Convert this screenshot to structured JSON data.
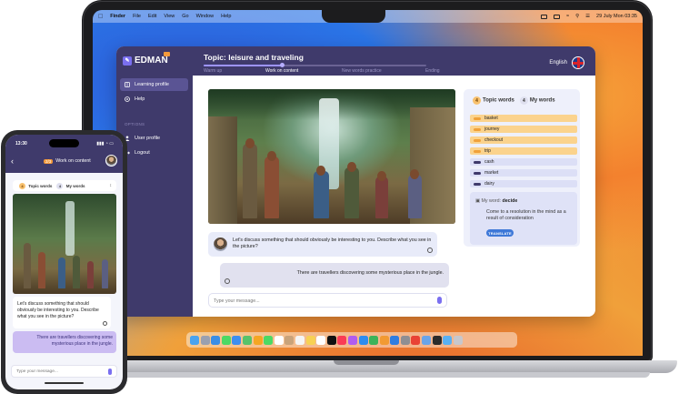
{
  "menubar": {
    "items": [
      "Finder",
      "File",
      "Edit",
      "View",
      "Go",
      "Window",
      "Help"
    ],
    "datetime": "29 July Mon  03:35"
  },
  "app": {
    "brand": "EDMAN",
    "topic_title": "Topic: leisure and traveling",
    "progress": 0.35,
    "steps": [
      "Warm up",
      "Work on content",
      "New words practice",
      "Ending"
    ],
    "active_step": 1,
    "language": "English",
    "sidebar": {
      "items": [
        {
          "label": "Learning profile",
          "icon": "book-icon"
        },
        {
          "label": "Help",
          "icon": "help-icon"
        }
      ],
      "section_label": "OPTIONS",
      "options": [
        {
          "label": "User profile",
          "icon": "user-icon"
        },
        {
          "label": "Logout",
          "icon": "logout-icon"
        }
      ]
    },
    "chat": {
      "bot_message": "Let's discuss something that should obviously be interesting to you. Describe what you see in the picture?",
      "user_message": "There are travellers discovering some mysterious place in the jungle.",
      "input_placeholder": "Type your message..."
    },
    "words": {
      "topic_count": "4",
      "topic_label": "Topic words",
      "my_count": "4",
      "my_label": "My words",
      "topic_words": [
        "basket",
        "journey",
        "checkout",
        "trip"
      ],
      "my_words": [
        "cash",
        "market",
        "dairy"
      ],
      "definition": {
        "prefix": "My word:",
        "word": "decide",
        "text": "Come to a resolution in the mind as a result of consideration",
        "button": "TRANSLATE"
      }
    }
  },
  "phone": {
    "time": "13:30",
    "status": "▮▮▮ ◔ ▭",
    "step_number": "2/3",
    "title": "Work on content",
    "topic_count": "4",
    "topic_label": "Topic words",
    "my_count": "4",
    "my_label": "My words",
    "bot_message": "Let's discuss something that should obviously be interesting to you. Describe what you see in the picture?",
    "user_message": "There are travellers discovering some mysterious place in the jungle.",
    "input_placeholder": "Type your message..."
  },
  "colors": {
    "brand_dark": "#3f3a6b",
    "accent": "#7a6ff0",
    "topic_word": "#fbd38d",
    "my_word": "#dcdff6",
    "translate": "#3e78d8"
  },
  "dock_icons": [
    "finder-icon",
    "launchpad-icon",
    "safari-icon",
    "messages-icon",
    "mail-icon",
    "maps-icon",
    "photos-icon",
    "facetime-icon",
    "calendar-icon",
    "contacts-icon",
    "reminders-icon",
    "notes-icon",
    "freeform-icon",
    "appletv-icon",
    "music-icon",
    "podcasts-icon",
    "appstore-icon",
    "numbers-icon",
    "pages-icon",
    "keynote-icon",
    "settings-icon",
    "chrome-icon",
    "preview-icon",
    "terminal-icon",
    "downloads-icon",
    "trash-icon"
  ]
}
